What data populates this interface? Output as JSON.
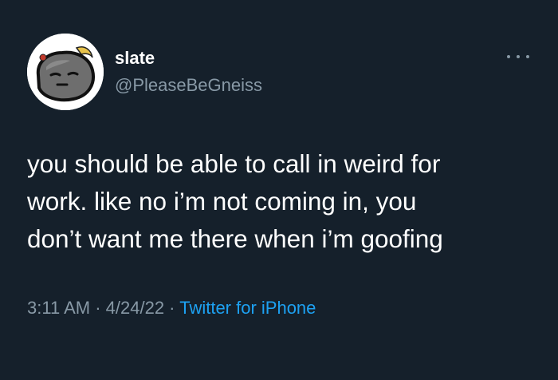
{
  "author": {
    "display_name": "slate",
    "handle": "@PleaseBeGneiss",
    "avatar_icon": "rock-character-avatar"
  },
  "more_icon": "more-options-icon",
  "tweet": {
    "lines": [
      "you should be able to call in weird for",
      "work. like no i’m not coming in, you",
      "don’t want me there when i’m goofing"
    ]
  },
  "meta": {
    "time": "3:11 AM",
    "sep1": " · ",
    "date": "4/24/22",
    "sep2": " · ",
    "source": "Twitter for iPhone"
  },
  "colors": {
    "background": "#15202b",
    "secondary_text": "#8899a6",
    "link": "#1da1f2"
  }
}
